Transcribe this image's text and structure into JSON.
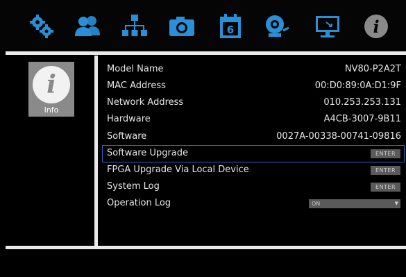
{
  "toolbar": {
    "items": [
      {
        "icon": "settings-gears-icon",
        "color": "#2a8fd6"
      },
      {
        "icon": "users-icon",
        "color": "#2a8fd6"
      },
      {
        "icon": "network-icon",
        "color": "#2a8fd6"
      },
      {
        "icon": "camera-icon",
        "color": "#2a8fd6"
      },
      {
        "icon": "calendar-icon",
        "color": "#2a8fd6",
        "text": "6"
      },
      {
        "icon": "alarm-bell-icon",
        "color": "#2a8fd6"
      },
      {
        "icon": "display-icon",
        "color": "#2a8fd6"
      },
      {
        "icon": "info-icon",
        "color": "#8a8a8a"
      }
    ]
  },
  "sidebar": {
    "info_label": "Info",
    "info_glyph": "i"
  },
  "info": {
    "model_name": {
      "label": "Model Name",
      "value": "NV80-P2A2T"
    },
    "mac_address": {
      "label": "MAC Address",
      "value": "00:D0:89:0A:D1:9F"
    },
    "network_address": {
      "label": "Network Address",
      "value": "010.253.253.131"
    },
    "hardware": {
      "label": "Hardware",
      "value": "A4CB-3007-9B11"
    },
    "software": {
      "label": "Software",
      "value": "0027A-00338-00741-09816"
    }
  },
  "actions": {
    "software_upgrade": {
      "label": "Software Upgrade",
      "button": "ENTER"
    },
    "fpga_upgrade": {
      "label": "FPGA Upgrade Via Local Device",
      "button": "ENTER"
    },
    "system_log": {
      "label": "System Log",
      "button": "ENTER"
    },
    "operation_log": {
      "label": "Operation Log",
      "value": "ON"
    }
  },
  "colors": {
    "accent": "#2a8fd6",
    "selection": "#2f63c8",
    "button": "#5a5a5a"
  }
}
